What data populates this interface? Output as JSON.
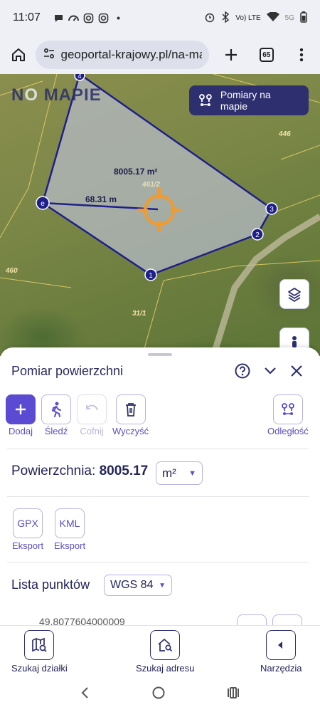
{
  "status": {
    "time": "11:07",
    "network": "Vo) LTE",
    "network2": "5G"
  },
  "browser": {
    "url": "geoportal-krajowy.pl/na-ma",
    "tab_count": "65"
  },
  "map": {
    "logo_part1": "N",
    "logo_part2": "O",
    "logo_part3": "MAPIE",
    "measure_button": "Pomiary na mapie",
    "area_label": "8005.17 m²",
    "parcel_main": "461/2",
    "distance_label": "68.31 m",
    "parcel_labels": [
      "446",
      "460",
      "31/1"
    ],
    "vertex_labels": [
      "4",
      "3",
      "2",
      "1"
    ]
  },
  "panel": {
    "title": "Pomiar powierzchni",
    "tools": [
      {
        "label": "Dodaj"
      },
      {
        "label": "Śledź"
      },
      {
        "label": "Cofnij"
      },
      {
        "label": "Wyczyść"
      },
      {
        "label": "Odległość"
      }
    ],
    "area_prefix": "Powierzchnia:",
    "area_value": "8005.17",
    "unit": "m²",
    "exports": [
      {
        "format": "GPX",
        "label": "Eksport"
      },
      {
        "format": "KML",
        "label": "Eksport"
      }
    ],
    "points_label": "Lista punktów",
    "crs": "WGS 84",
    "first_coord": "49.8077604000009"
  },
  "bottom_nav": {
    "items": [
      {
        "label": "Szukaj działki"
      },
      {
        "label": "Szukaj adresu"
      },
      {
        "label": "Narzędzia"
      }
    ]
  },
  "colors": {
    "accent": "#5b4bd3",
    "navy": "#2e2f6e",
    "polygon_stroke": "#1f1f8a",
    "crosshair": "#f39a2b"
  }
}
